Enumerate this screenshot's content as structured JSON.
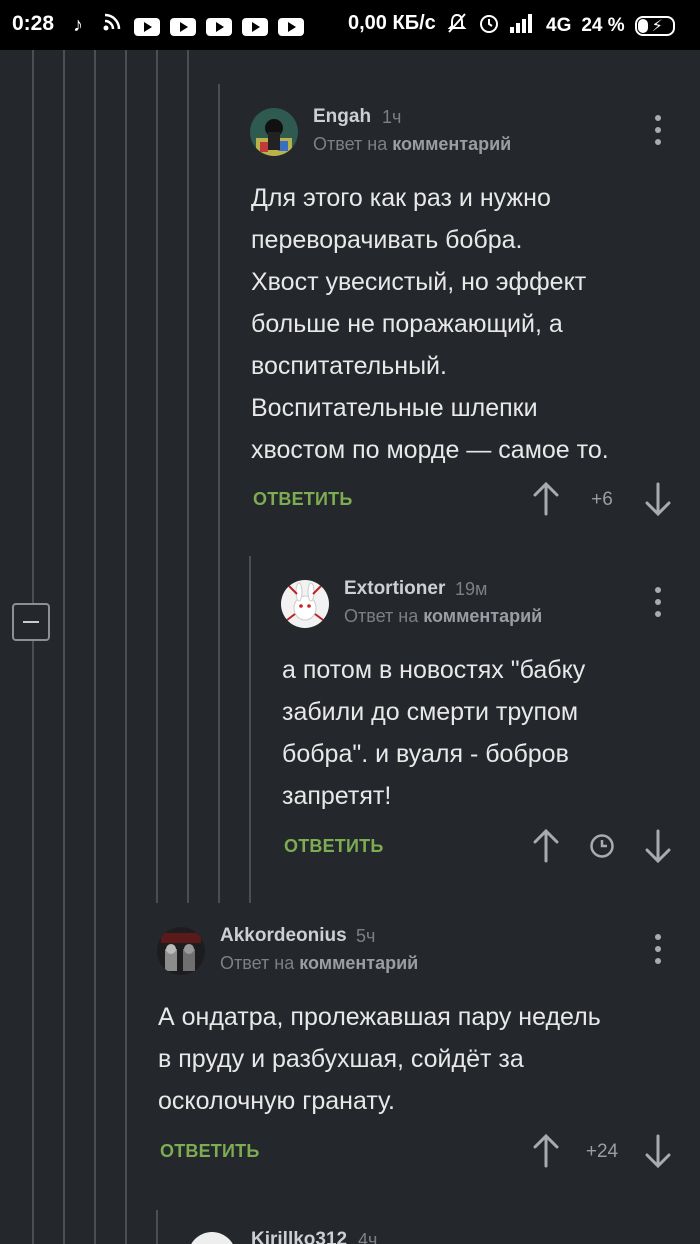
{
  "status_bar": {
    "time": "0:28",
    "left_icons": [
      "tiktok-icon",
      "rss-icon",
      "youtube-icon",
      "youtube-icon",
      "youtube-icon",
      "youtube-icon",
      "youtube-icon"
    ],
    "speed": "0,00 КБ/с",
    "network": "4G",
    "battery_percent": "24 %",
    "battery_level": 0.24
  },
  "comments": [
    {
      "username": "Engah",
      "time": "1ч",
      "reply_prefix": "Ответ на",
      "reply_target": "комментарий",
      "text": "Для этого как раз и нужно\nпереворачивать бобра.\nХвост увесистый, но эффект\nбольше не поражающий, а\nвоспитательный.\nВоспитательные шлепки\nхвостом по морде — самое то.",
      "reply_label": "ОТВЕТИТЬ",
      "rating": "+6"
    },
    {
      "username": "Extortioner",
      "time": "19м",
      "reply_prefix": "Ответ на",
      "reply_target": "комментарий",
      "text": "а потом в новостях \"бабку\nзабили до смерти трупом\nбобра\". и вуаля - бобров\nзапретят!",
      "reply_label": "ОТВЕТИТЬ",
      "rating_icon": "clock-icon"
    },
    {
      "username": "Akkordeonius",
      "time": "5ч",
      "reply_prefix": "Ответ на",
      "reply_target": "комментарий",
      "text": "А ондатра, пролежавшая пару недель\nв пруду и разбухшая, сойдёт за\nосколочную гранату.",
      "reply_label": "ОТВЕТИТЬ",
      "rating": "+24"
    },
    {
      "username": "Kirillko312",
      "time": "4ч"
    }
  ],
  "colors": {
    "background": "#24272b",
    "accent_green": "#7cad52",
    "thread_line": "#4b4e52"
  }
}
